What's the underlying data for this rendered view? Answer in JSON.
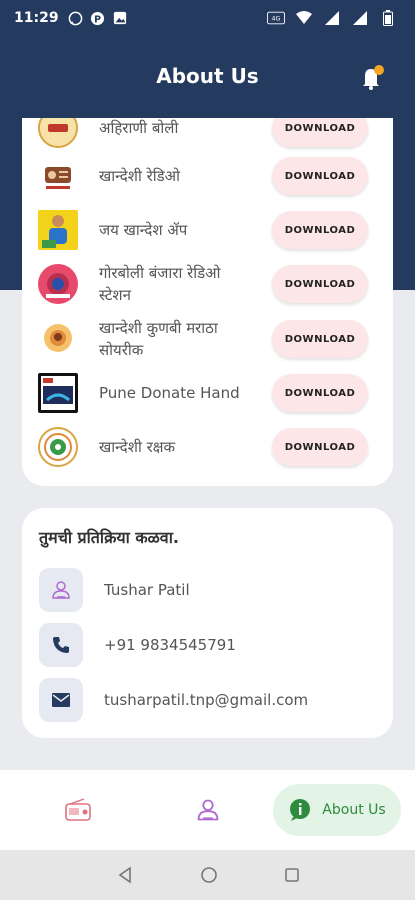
{
  "status_bar": {
    "time": "11:29"
  },
  "header": {
    "title": "About Us"
  },
  "apps": [
    {
      "name": "अहिराणी बोली",
      "download_label": "DOWNLOAD"
    },
    {
      "name": "खान्देशी रेडिओ",
      "download_label": "DOWNLOAD"
    },
    {
      "name": "जय खान्देश ॲप",
      "download_label": "DOWNLOAD"
    },
    {
      "name": "गोरबोली बंजारा रेडिओ स्टेशन",
      "download_label": "DOWNLOAD"
    },
    {
      "name": "खान्देशी कुणबी मराठा सोयरीक",
      "download_label": "DOWNLOAD"
    },
    {
      "name": "Pune Donate Hand",
      "download_label": "DOWNLOAD"
    },
    {
      "name": "खान्देशी रक्षक",
      "download_label": "DOWNLOAD"
    }
  ],
  "contact": {
    "heading": "तुमची प्रतिक्रिया कळवा.",
    "name": "Tushar Patil",
    "phone": "+91 9834545791",
    "email": "tusharpatil.tnp@gmail.com"
  },
  "bottom_nav": {
    "active_label": "About Us"
  },
  "colors": {
    "navy": "#243a5e",
    "download_bg": "#fde6e8",
    "active_nav_bg": "#e3f3e5",
    "active_nav_text": "#2e8b3e",
    "notification_dot": "#f5a623"
  }
}
